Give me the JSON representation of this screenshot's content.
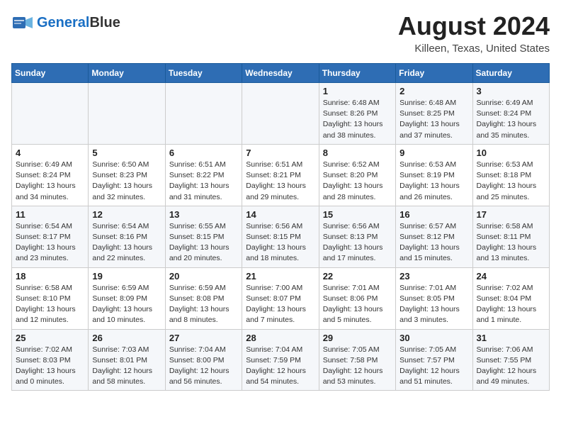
{
  "header": {
    "logo_line1": "General",
    "logo_line2": "Blue",
    "month_title": "August 2024",
    "location": "Killeen, Texas, United States"
  },
  "weekdays": [
    "Sunday",
    "Monday",
    "Tuesday",
    "Wednesday",
    "Thursday",
    "Friday",
    "Saturday"
  ],
  "weeks": [
    [
      {
        "day": "",
        "info": ""
      },
      {
        "day": "",
        "info": ""
      },
      {
        "day": "",
        "info": ""
      },
      {
        "day": "",
        "info": ""
      },
      {
        "day": "1",
        "info": "Sunrise: 6:48 AM\nSunset: 8:26 PM\nDaylight: 13 hours\nand 38 minutes."
      },
      {
        "day": "2",
        "info": "Sunrise: 6:48 AM\nSunset: 8:25 PM\nDaylight: 13 hours\nand 37 minutes."
      },
      {
        "day": "3",
        "info": "Sunrise: 6:49 AM\nSunset: 8:24 PM\nDaylight: 13 hours\nand 35 minutes."
      }
    ],
    [
      {
        "day": "4",
        "info": "Sunrise: 6:49 AM\nSunset: 8:24 PM\nDaylight: 13 hours\nand 34 minutes."
      },
      {
        "day": "5",
        "info": "Sunrise: 6:50 AM\nSunset: 8:23 PM\nDaylight: 13 hours\nand 32 minutes."
      },
      {
        "day": "6",
        "info": "Sunrise: 6:51 AM\nSunset: 8:22 PM\nDaylight: 13 hours\nand 31 minutes."
      },
      {
        "day": "7",
        "info": "Sunrise: 6:51 AM\nSunset: 8:21 PM\nDaylight: 13 hours\nand 29 minutes."
      },
      {
        "day": "8",
        "info": "Sunrise: 6:52 AM\nSunset: 8:20 PM\nDaylight: 13 hours\nand 28 minutes."
      },
      {
        "day": "9",
        "info": "Sunrise: 6:53 AM\nSunset: 8:19 PM\nDaylight: 13 hours\nand 26 minutes."
      },
      {
        "day": "10",
        "info": "Sunrise: 6:53 AM\nSunset: 8:18 PM\nDaylight: 13 hours\nand 25 minutes."
      }
    ],
    [
      {
        "day": "11",
        "info": "Sunrise: 6:54 AM\nSunset: 8:17 PM\nDaylight: 13 hours\nand 23 minutes."
      },
      {
        "day": "12",
        "info": "Sunrise: 6:54 AM\nSunset: 8:16 PM\nDaylight: 13 hours\nand 22 minutes."
      },
      {
        "day": "13",
        "info": "Sunrise: 6:55 AM\nSunset: 8:15 PM\nDaylight: 13 hours\nand 20 minutes."
      },
      {
        "day": "14",
        "info": "Sunrise: 6:56 AM\nSunset: 8:15 PM\nDaylight: 13 hours\nand 18 minutes."
      },
      {
        "day": "15",
        "info": "Sunrise: 6:56 AM\nSunset: 8:13 PM\nDaylight: 13 hours\nand 17 minutes."
      },
      {
        "day": "16",
        "info": "Sunrise: 6:57 AM\nSunset: 8:12 PM\nDaylight: 13 hours\nand 15 minutes."
      },
      {
        "day": "17",
        "info": "Sunrise: 6:58 AM\nSunset: 8:11 PM\nDaylight: 13 hours\nand 13 minutes."
      }
    ],
    [
      {
        "day": "18",
        "info": "Sunrise: 6:58 AM\nSunset: 8:10 PM\nDaylight: 13 hours\nand 12 minutes."
      },
      {
        "day": "19",
        "info": "Sunrise: 6:59 AM\nSunset: 8:09 PM\nDaylight: 13 hours\nand 10 minutes."
      },
      {
        "day": "20",
        "info": "Sunrise: 6:59 AM\nSunset: 8:08 PM\nDaylight: 13 hours\nand 8 minutes."
      },
      {
        "day": "21",
        "info": "Sunrise: 7:00 AM\nSunset: 8:07 PM\nDaylight: 13 hours\nand 7 minutes."
      },
      {
        "day": "22",
        "info": "Sunrise: 7:01 AM\nSunset: 8:06 PM\nDaylight: 13 hours\nand 5 minutes."
      },
      {
        "day": "23",
        "info": "Sunrise: 7:01 AM\nSunset: 8:05 PM\nDaylight: 13 hours\nand 3 minutes."
      },
      {
        "day": "24",
        "info": "Sunrise: 7:02 AM\nSunset: 8:04 PM\nDaylight: 13 hours\nand 1 minute."
      }
    ],
    [
      {
        "day": "25",
        "info": "Sunrise: 7:02 AM\nSunset: 8:03 PM\nDaylight: 13 hours\nand 0 minutes."
      },
      {
        "day": "26",
        "info": "Sunrise: 7:03 AM\nSunset: 8:01 PM\nDaylight: 12 hours\nand 58 minutes."
      },
      {
        "day": "27",
        "info": "Sunrise: 7:04 AM\nSunset: 8:00 PM\nDaylight: 12 hours\nand 56 minutes."
      },
      {
        "day": "28",
        "info": "Sunrise: 7:04 AM\nSunset: 7:59 PM\nDaylight: 12 hours\nand 54 minutes."
      },
      {
        "day": "29",
        "info": "Sunrise: 7:05 AM\nSunset: 7:58 PM\nDaylight: 12 hours\nand 53 minutes."
      },
      {
        "day": "30",
        "info": "Sunrise: 7:05 AM\nSunset: 7:57 PM\nDaylight: 12 hours\nand 51 minutes."
      },
      {
        "day": "31",
        "info": "Sunrise: 7:06 AM\nSunset: 7:55 PM\nDaylight: 12 hours\nand 49 minutes."
      }
    ]
  ]
}
